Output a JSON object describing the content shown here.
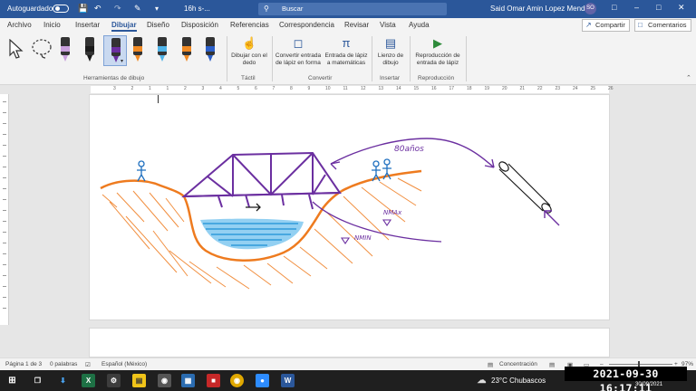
{
  "titlebar": {
    "autosave_label": "Autoguardado",
    "doc_name": "16h s-...",
    "search_placeholder": "Buscar",
    "user_name": "Said Omar Amin Lopez Mendez",
    "user_initials": "SO"
  },
  "tabs": [
    {
      "label": "Archivo"
    },
    {
      "label": "Inicio"
    },
    {
      "label": "Insertar"
    },
    {
      "label": "Dibujar",
      "active": true
    },
    {
      "label": "Diseño"
    },
    {
      "label": "Disposición"
    },
    {
      "label": "Referencias"
    },
    {
      "label": "Correspondencia"
    },
    {
      "label": "Revisar"
    },
    {
      "label": "Vista"
    },
    {
      "label": "Ayuda"
    }
  ],
  "ribbon_actions": {
    "share_label": "Compartir",
    "comments_label": "Comentarios"
  },
  "ribbon": {
    "tools_group_label": "Herramientas de dibujo",
    "touch": {
      "button": "Dibujar con el dedo",
      "group": "Táctil"
    },
    "convert": {
      "shape_button": "Convertir entrada de lápiz en forma",
      "math_button": "Entrada de lápiz a matemáticas",
      "group": "Convertir"
    },
    "insert": {
      "canvas_button": "Lienzo de dibujo",
      "group": "Insertar"
    },
    "replay": {
      "button": "Reproducción de entrada de lápiz",
      "group": "Reproducción"
    },
    "pens": [
      {
        "color": "#c9a0dc"
      },
      {
        "color": "#1a1a1a"
      },
      {
        "color": "#1e7fd6"
      },
      {
        "color": "#6b2fa0"
      },
      {
        "color": "#f08a24"
      },
      {
        "color": "#4fb3e8"
      },
      {
        "color": "#f08a24"
      },
      {
        "color": "#2b5fc9"
      }
    ]
  },
  "ruler": {
    "numbers": [
      "3",
      "2",
      "1",
      "1",
      "2",
      "3",
      "4",
      "5",
      "6",
      "7",
      "8",
      "9",
      "10",
      "11",
      "12",
      "13",
      "14",
      "15",
      "16",
      "17",
      "18",
      "19",
      "20",
      "21",
      "22",
      "23",
      "24",
      "25",
      "26"
    ]
  },
  "drawing": {
    "annotation_years": "80años",
    "label_nmax": "NMAx",
    "label_nmin": "NMIN"
  },
  "statusbar": {
    "page": "Página 1 de 3",
    "words": "0 palabras",
    "language": "Español (México)",
    "focus": "Concentración",
    "zoom": "97%"
  },
  "taskbar": {
    "weather": "23°C  Chubascos",
    "clock_overlay": "2021-09-30  16:17:11",
    "date_small": "30/09/2021"
  }
}
